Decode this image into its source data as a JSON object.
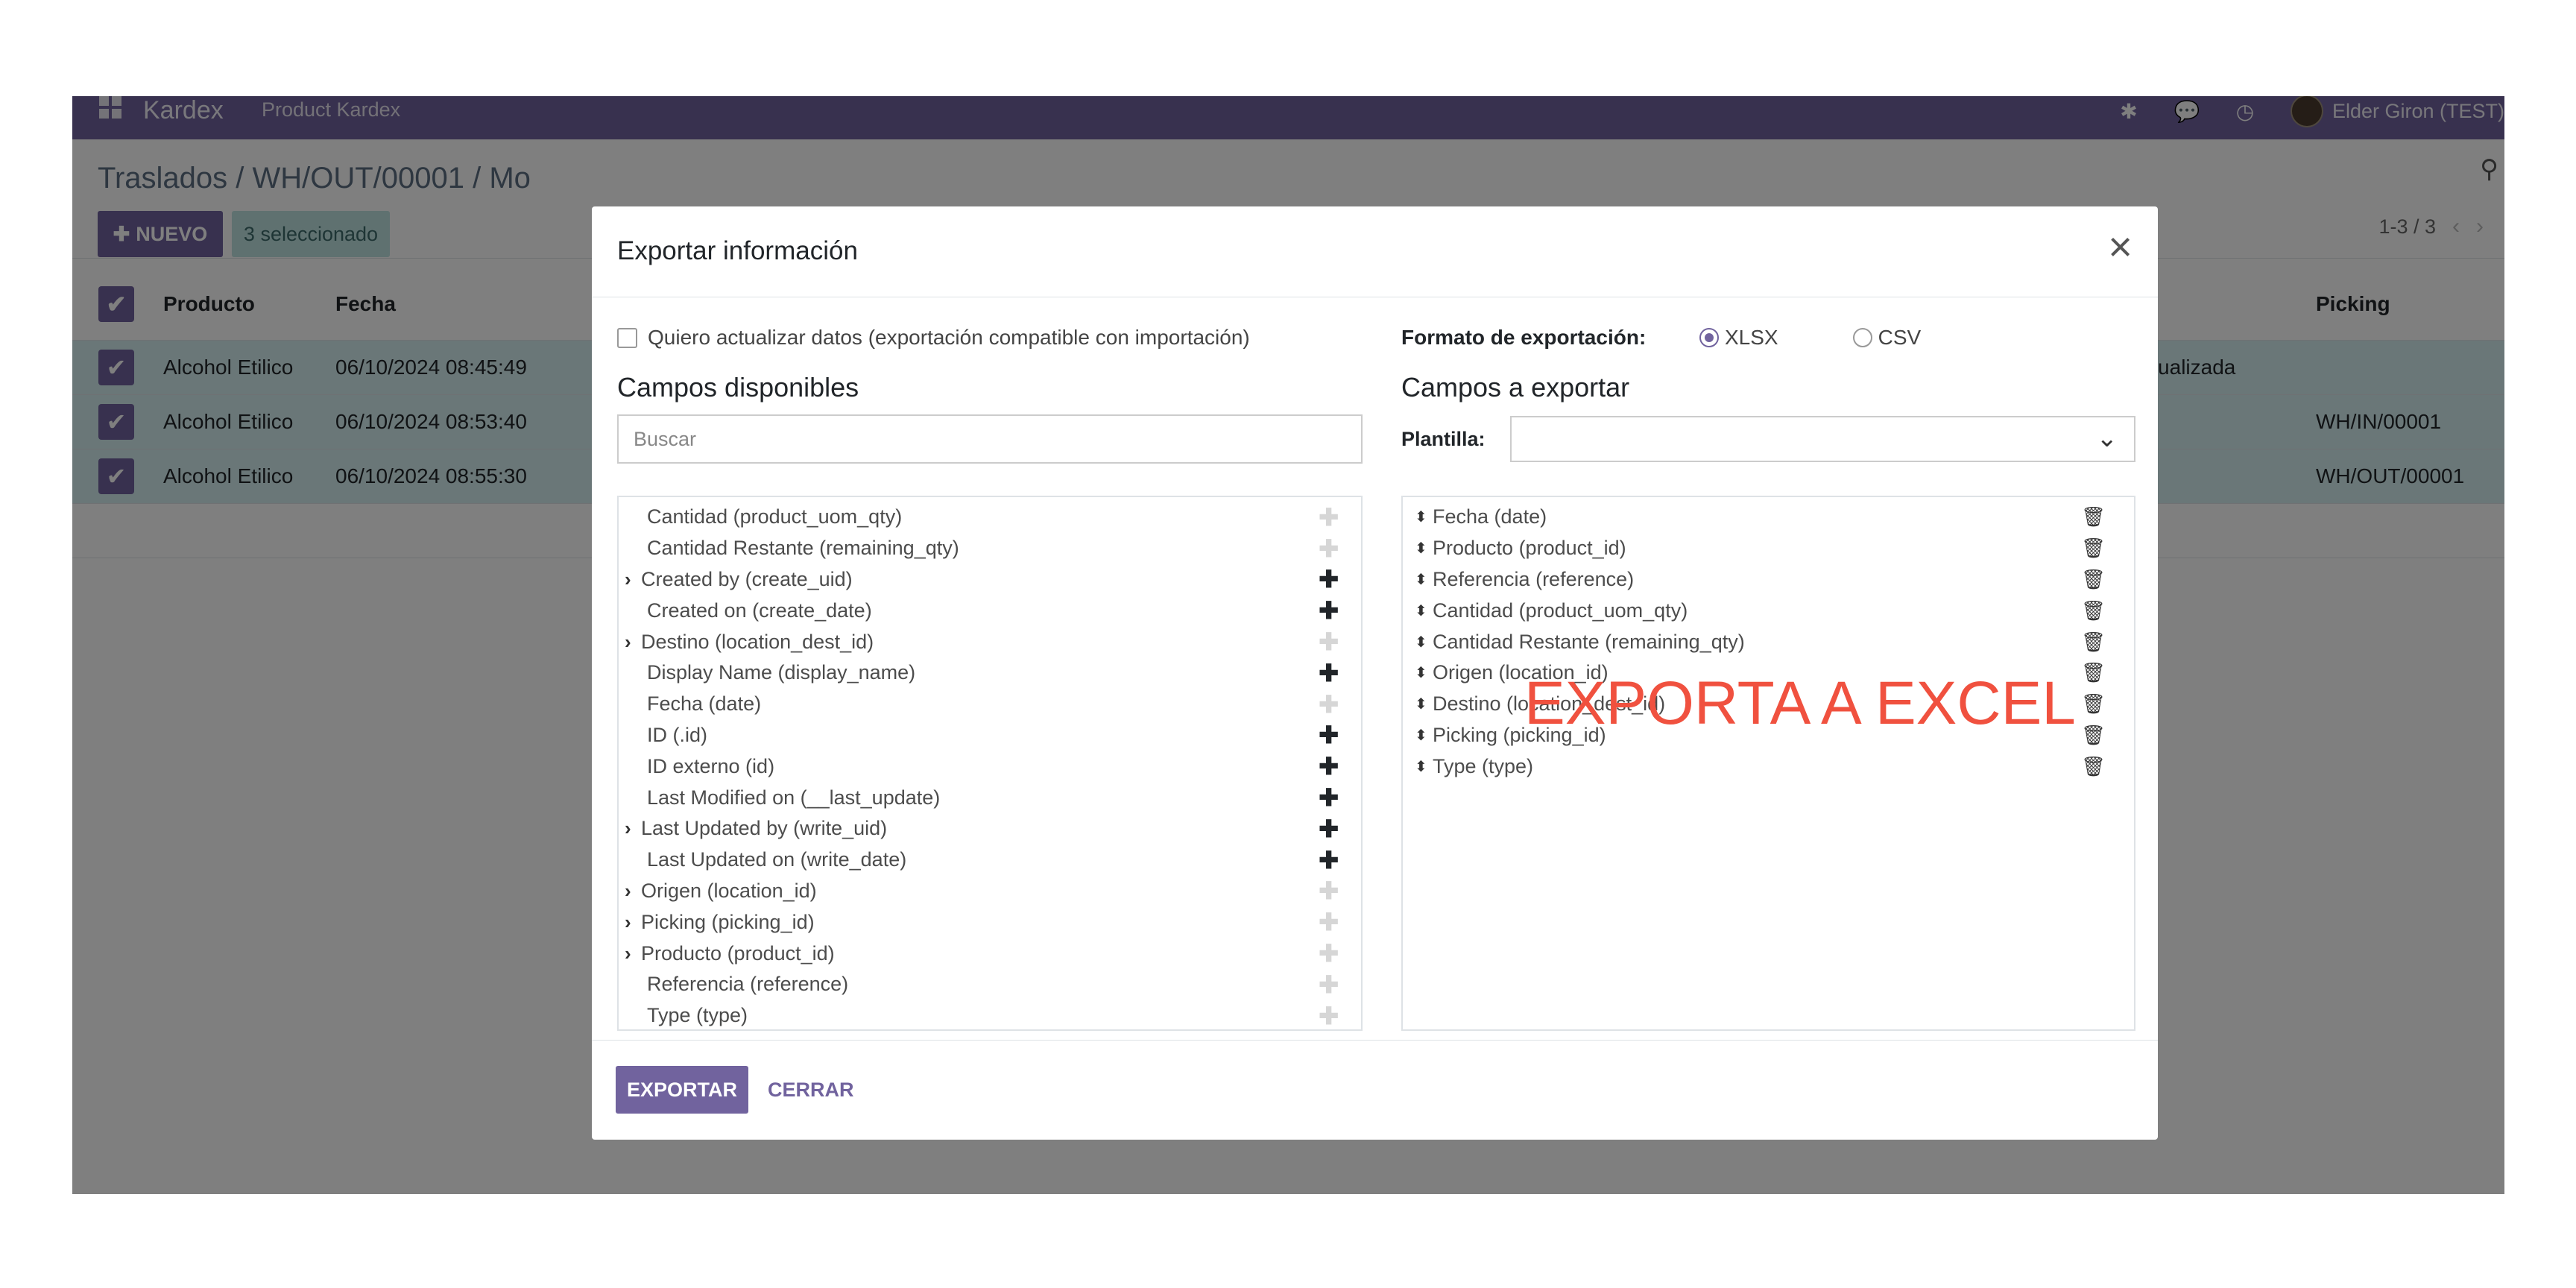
{
  "navbar": {
    "app_name": "Kardex",
    "menu": "Product Kardex",
    "user": "Elder Giron (TEST)"
  },
  "control": {
    "breadcrumb": "Traslados / WH/OUT/00001 / Mo",
    "new_button": "NUEVO",
    "selected_badge": "3 seleccionado",
    "pager": "1-3 / 3"
  },
  "list": {
    "headers": {
      "producto": "Producto",
      "fecha": "Fecha",
      "picking": "Picking"
    },
    "rows": [
      {
        "producto": "Alcohol Etilico",
        "fecha": "06/10/2024 08:45:49",
        "desc": "ucto actualizada",
        "picking": ""
      },
      {
        "producto": "Alcohol Etilico",
        "fecha": "06/10/2024 08:53:40",
        "desc": "",
        "picking": "WH/IN/00001"
      },
      {
        "producto": "Alcohol Etilico",
        "fecha": "06/10/2024 08:55:30",
        "desc": "",
        "picking": "WH/OUT/00001"
      }
    ]
  },
  "modal": {
    "title": "Exportar información",
    "close_icon": "close-icon",
    "update_checkbox_label": "Quiero actualizar datos (exportación compatible con importación)",
    "available_title": "Campos disponibles",
    "search_placeholder": "Buscar",
    "available_fields": [
      {
        "label": "Cantidad (product_uom_qty)",
        "expandable": false,
        "addable": false
      },
      {
        "label": "Cantidad Restante (remaining_qty)",
        "expandable": false,
        "addable": false
      },
      {
        "label": "Created by (create_uid)",
        "expandable": true,
        "addable": true
      },
      {
        "label": "Created on (create_date)",
        "expandable": false,
        "addable": true
      },
      {
        "label": "Destino (location_dest_id)",
        "expandable": true,
        "addable": false
      },
      {
        "label": "Display Name (display_name)",
        "expandable": false,
        "addable": true
      },
      {
        "label": "Fecha (date)",
        "expandable": false,
        "addable": false
      },
      {
        "label": "ID (.id)",
        "expandable": false,
        "addable": true
      },
      {
        "label": "ID externo (id)",
        "expandable": false,
        "addable": true
      },
      {
        "label": "Last Modified on (__last_update)",
        "expandable": false,
        "addable": true
      },
      {
        "label": "Last Updated by (write_uid)",
        "expandable": true,
        "addable": true
      },
      {
        "label": "Last Updated on (write_date)",
        "expandable": false,
        "addable": true
      },
      {
        "label": "Origen (location_id)",
        "expandable": true,
        "addable": false
      },
      {
        "label": "Picking (picking_id)",
        "expandable": true,
        "addable": false
      },
      {
        "label": "Producto (product_id)",
        "expandable": true,
        "addable": false
      },
      {
        "label": "Referencia (reference)",
        "expandable": false,
        "addable": false
      },
      {
        "label": "Type (type)",
        "expandable": false,
        "addable": false
      }
    ],
    "format_label": "Formato de exportación:",
    "formats": [
      {
        "label": "XLSX",
        "selected": true
      },
      {
        "label": "CSV",
        "selected": false
      }
    ],
    "export_title": "Campos a exportar",
    "template_label": "Plantilla:",
    "template_value": "",
    "export_fields": [
      "Fecha (date)",
      "Producto (product_id)",
      "Referencia (reference)",
      "Cantidad (product_uom_qty)",
      "Cantidad Restante (remaining_qty)",
      "Origen (location_id)",
      "Destino (location_dest_id)",
      "Picking (picking_id)",
      "Type (type)"
    ],
    "annotation": "EXPORTA A EXCEL",
    "export_button": "EXPORTAR",
    "close_button": "CERRAR"
  },
  "colors": {
    "brand": "#71639e",
    "selected_row": "#d4eff0",
    "annotation": "#f0513f"
  }
}
